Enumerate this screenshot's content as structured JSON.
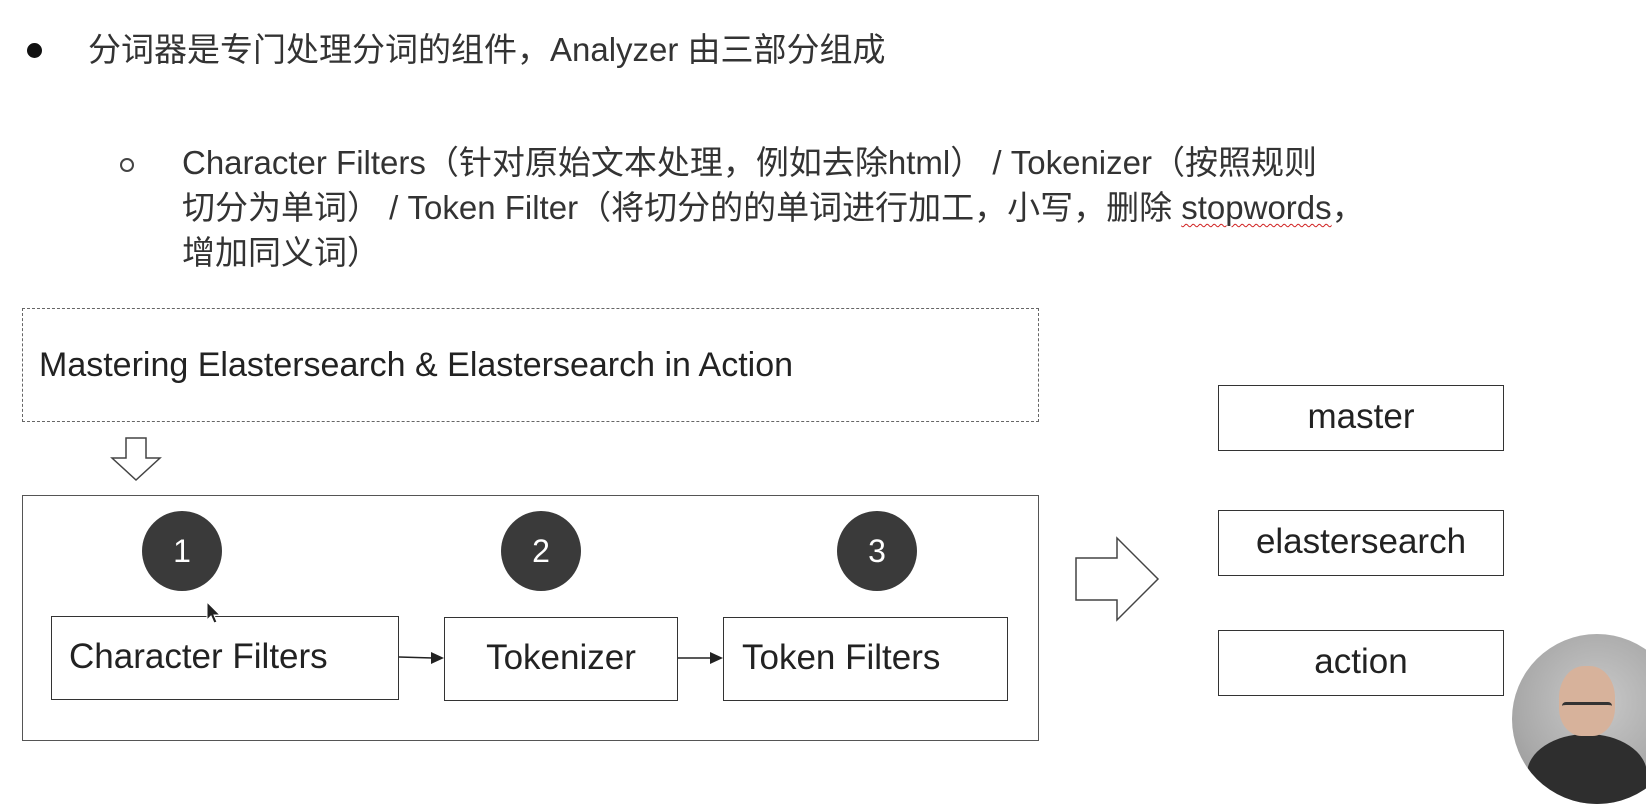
{
  "slide": {
    "bullet": "分词器是专门处理分词的组件，Analyzer 由三部分组成",
    "sub_bullet": {
      "line1": "Character Filters（针对原始文本处理，例如去除html） / Tokenizer（按照规则",
      "line2_prefix": "切分为单词） / Token Filter（将切分的的单词进行加工，小写，删除 ",
      "line2_spell": "stopwords",
      "line2_suffix": "，",
      "line3": "增加同义词）"
    }
  },
  "diagram": {
    "input_text": "Mastering Elastersearch & Elastersearch in Action",
    "stages": [
      {
        "step": "1",
        "label": "Character Filters"
      },
      {
        "step": "2",
        "label": "Tokenizer"
      },
      {
        "step": "3",
        "label": "Token Filters"
      }
    ],
    "tokens": [
      "master",
      "elastersearch",
      "action"
    ]
  },
  "colors": {
    "badge": "#3a3a3a",
    "border": "#333333",
    "text": "#333333",
    "spellcheck": "#d02020"
  }
}
